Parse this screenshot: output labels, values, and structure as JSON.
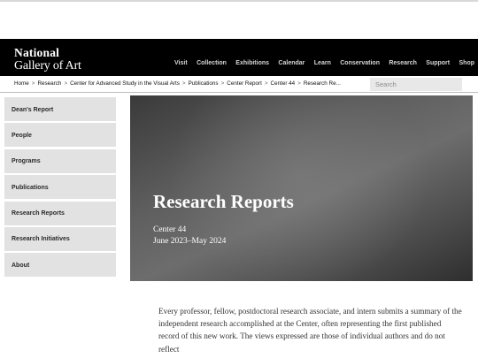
{
  "header": {
    "logo_line1": "National",
    "logo_line2": "Gallery of Art",
    "nav": [
      "Visit",
      "Collection",
      "Exhibitions",
      "Calendar",
      "Learn",
      "Conservation",
      "Research",
      "Support",
      "Shop"
    ]
  },
  "breadcrumb": [
    "Home",
    "Research",
    "Center for Advanced Study in the Visual Arts",
    "Publications",
    "Center Report",
    "Center 44",
    "Research Re..."
  ],
  "breadcrumb_separator": ">",
  "search": {
    "placeholder": "Search",
    "value": ""
  },
  "sidebar": {
    "items": [
      "Dean's Report",
      "People",
      "Programs",
      "Publications",
      "Research Reports",
      "Research Initiatives",
      "About"
    ]
  },
  "hero": {
    "title": "Research Reports",
    "subtitle_line1": "Center 44",
    "subtitle_line2": "June 2023–May 2024"
  },
  "intro": {
    "text": "Every professor, fellow, postdoctoral research associate, and intern submits a summary of the independent research accomplished at the Center, often representing the first published record of this new work. The views expressed are those of individual authors and do not reflect"
  },
  "colors": {
    "header_bg": "#000000",
    "sidebar_item_bg": "#e2e2e2",
    "search_bg": "#e8e8e8",
    "hero_text": "#ffffff"
  }
}
